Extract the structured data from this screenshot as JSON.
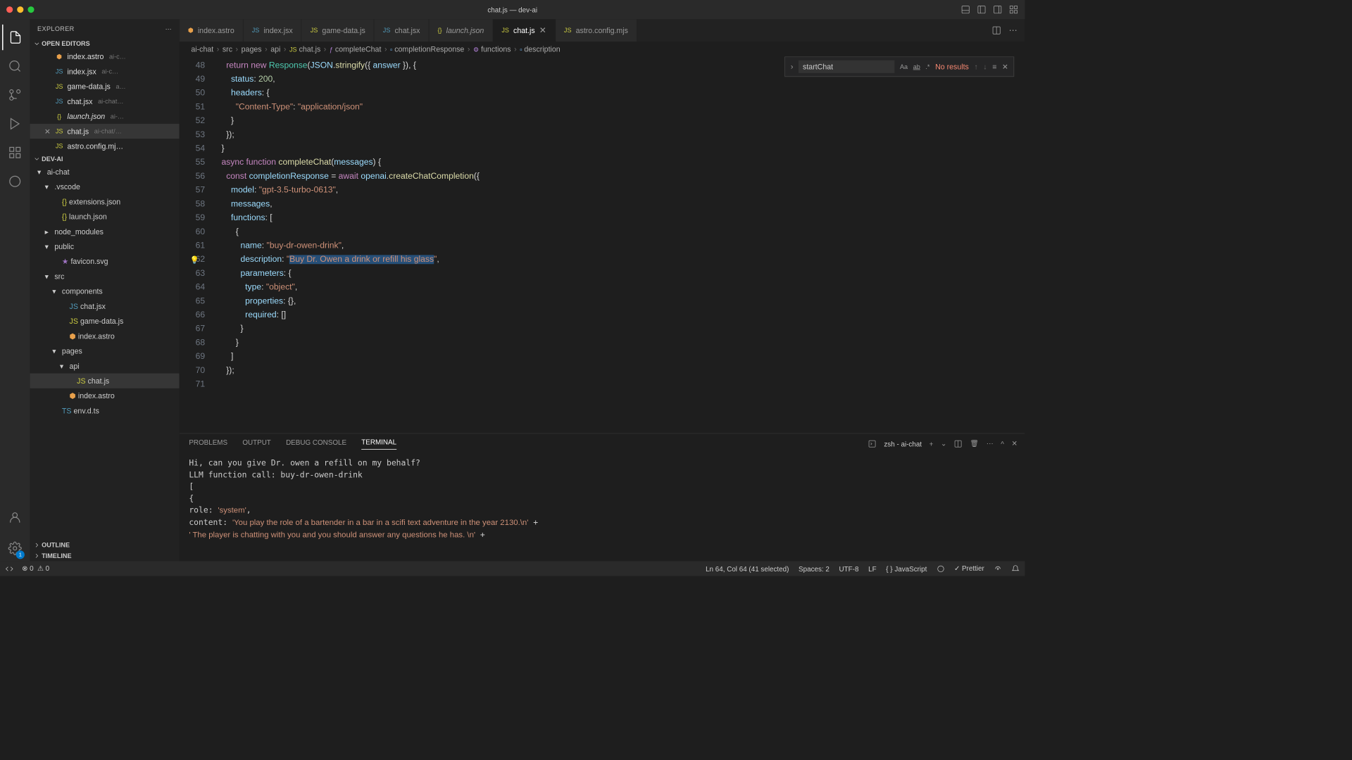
{
  "window": {
    "title": "chat.js — dev-ai"
  },
  "sidebar": {
    "title": "EXPLORER",
    "openEditors": "OPEN EDITORS",
    "project": "DEV-AI",
    "outline": "OUTLINE",
    "timeline": "TIMELINE",
    "editors": [
      {
        "icon": "⬢",
        "name": "index.astro",
        "dim": "ai-c…",
        "color": "f-orng"
      },
      {
        "icon": "JS",
        "name": "index.jsx",
        "dim": "ai-c…",
        "color": "f-blu"
      },
      {
        "icon": "JS",
        "name": "game-data.js",
        "dim": "a…",
        "color": "f-yel"
      },
      {
        "icon": "JS",
        "name": "chat.jsx",
        "dim": "ai-chat…",
        "color": "f-blu"
      },
      {
        "icon": "{}",
        "name": "launch.json",
        "dim": "ai-…",
        "italic": true,
        "color": "f-yel"
      },
      {
        "icon": "JS",
        "name": "chat.js",
        "dim": "ai-chat/…",
        "active": true,
        "close": true,
        "color": "f-yel"
      },
      {
        "icon": "JS",
        "name": "astro.config.mj…",
        "dim": "",
        "color": "f-yel"
      }
    ],
    "tree": [
      {
        "depth": 0,
        "chev": "▾",
        "name": "ai-chat",
        "folder": true
      },
      {
        "depth": 1,
        "chev": "▾",
        "name": ".vscode",
        "folder": true
      },
      {
        "depth": 2,
        "icon": "{}",
        "name": "extensions.json",
        "color": "f-yel"
      },
      {
        "depth": 2,
        "icon": "{}",
        "name": "launch.json",
        "color": "f-yel"
      },
      {
        "depth": 1,
        "chev": "▸",
        "name": "node_modules",
        "folder": true
      },
      {
        "depth": 1,
        "chev": "▾",
        "name": "public",
        "folder": true
      },
      {
        "depth": 2,
        "icon": "★",
        "name": "favicon.svg",
        "color": "f-purp"
      },
      {
        "depth": 1,
        "chev": "▾",
        "name": "src",
        "folder": true
      },
      {
        "depth": 2,
        "chev": "▾",
        "name": "components",
        "folder": true
      },
      {
        "depth": 3,
        "icon": "JS",
        "name": "chat.jsx",
        "color": "f-blu"
      },
      {
        "depth": 3,
        "icon": "JS",
        "name": "game-data.js",
        "color": "f-yel"
      },
      {
        "depth": 3,
        "icon": "⬢",
        "name": "index.astro",
        "color": "f-orng"
      },
      {
        "depth": 2,
        "chev": "▾",
        "name": "pages",
        "folder": true
      },
      {
        "depth": 3,
        "chev": "▾",
        "name": "api",
        "folder": true
      },
      {
        "depth": 4,
        "icon": "JS",
        "name": "chat.js",
        "color": "f-yel",
        "active": true
      },
      {
        "depth": 3,
        "icon": "⬢",
        "name": "index.astro",
        "color": "f-orng"
      },
      {
        "depth": 2,
        "icon": "TS",
        "name": "env.d.ts",
        "color": "f-blu"
      }
    ]
  },
  "tabs": [
    {
      "icon": "⬢",
      "label": "index.astro",
      "color": "f-orng"
    },
    {
      "icon": "JS",
      "label": "index.jsx",
      "color": "f-blu"
    },
    {
      "icon": "JS",
      "label": "game-data.js",
      "color": "f-yel"
    },
    {
      "icon": "JS",
      "label": "chat.jsx",
      "color": "f-blu"
    },
    {
      "icon": "{}",
      "label": "launch.json",
      "color": "f-yel",
      "italic": true
    },
    {
      "icon": "JS",
      "label": "chat.js",
      "color": "f-yel",
      "active": true,
      "close": true
    },
    {
      "icon": "JS",
      "label": "astro.config.mjs",
      "color": "f-yel"
    }
  ],
  "breadcrumbs": [
    "ai-chat",
    "src",
    "pages",
    "api",
    "chat.js",
    "completeChat",
    "completionResponse",
    "functions",
    "description"
  ],
  "search": {
    "value": "startChat",
    "noResults": "No results"
  },
  "code": {
    "startLine": 48,
    "lines": [
      {
        "n": 48,
        "html": "    <span class='kw'>return</span> <span class='kw'>new</span> <span class='typ'>Response</span>(<span class='var'>JSON</span>.<span class='fn'>stringify</span>({ <span class='var'>answer</span> }), {"
      },
      {
        "n": 49,
        "html": "      <span class='var'>status</span>: <span class='num'>200</span>,"
      },
      {
        "n": 50,
        "html": "      <span class='var'>headers</span>: {"
      },
      {
        "n": 51,
        "html": "        <span class='str'>\"Content-Type\"</span>: <span class='str'>\"application/json\"</span>"
      },
      {
        "n": 52,
        "html": "      }"
      },
      {
        "n": 53,
        "html": "    });"
      },
      {
        "n": 54,
        "html": "  }"
      },
      {
        "n": 55,
        "html": ""
      },
      {
        "n": 56,
        "html": "  <span class='kw'>async</span> <span class='kw'>function</span> <span class='fn'>completeChat</span>(<span class='var'>messages</span>) {"
      },
      {
        "n": 57,
        "html": "    <span class='kw'>const</span> <span class='var'>completionResponse</span> = <span class='kw'>await</span> <span class='var'>openai</span>.<span class='fn'>createChatCompletion</span>({"
      },
      {
        "n": 58,
        "html": "      <span class='var'>model</span>: <span class='str'>\"gpt-3.5-turbo-0613\"</span>,"
      },
      {
        "n": 59,
        "html": "      <span class='var'>messages</span>,"
      },
      {
        "n": 60,
        "html": "      <span class='var'>functions</span>: ["
      },
      {
        "n": 61,
        "html": "        {"
      },
      {
        "n": 62,
        "html": "          <span class='var'>name</span>: <span class='str'>\"buy-dr-owen-drink\"</span>,"
      },
      {
        "n": 63,
        "html": "          <span class='var'>description</span>: <span class='str'>\"<span class='sel'>Buy Dr. Owen a drink or refill his glass</span>\"</span>,",
        "bulb": true
      },
      {
        "n": 64,
        "html": "          <span class='var'>parameters</span>: {"
      },
      {
        "n": 65,
        "html": "            <span class='var'>type</span>: <span class='str'>\"object\"</span>,"
      },
      {
        "n": 66,
        "html": "            <span class='var'>properties</span>: {},"
      },
      {
        "n": 67,
        "html": "            <span class='var'>required</span>: []"
      },
      {
        "n": 68,
        "html": "          }"
      },
      {
        "n": 69,
        "html": "        }"
      },
      {
        "n": 70,
        "html": "      ]"
      },
      {
        "n": 71,
        "html": "    });"
      }
    ]
  },
  "panel": {
    "tabs": [
      "PROBLEMS",
      "OUTPUT",
      "DEBUG CONSOLE",
      "TERMINAL"
    ],
    "activeTab": 3,
    "shellLabel": "zsh - ai-chat",
    "terminal": "Hi, can you give Dr. owen a refill on my behalf?\nLLM function call:   buy-dr-owen-drink\n[\n  {\n    role: 'system',\n    content: 'You play the role of a bartender in a bar in a scifi text adventure in the year 2130.\\n' +\n      '        The player is chatting with you and you should answer any questions he has. \\n' +"
  },
  "status": {
    "errors": "0",
    "warnings": "0",
    "cursor": "Ln 64, Col 64 (41 selected)",
    "spaces": "Spaces: 2",
    "encoding": "UTF-8",
    "eol": "LF",
    "lang": "JavaScript",
    "prettier": "Prettier"
  }
}
